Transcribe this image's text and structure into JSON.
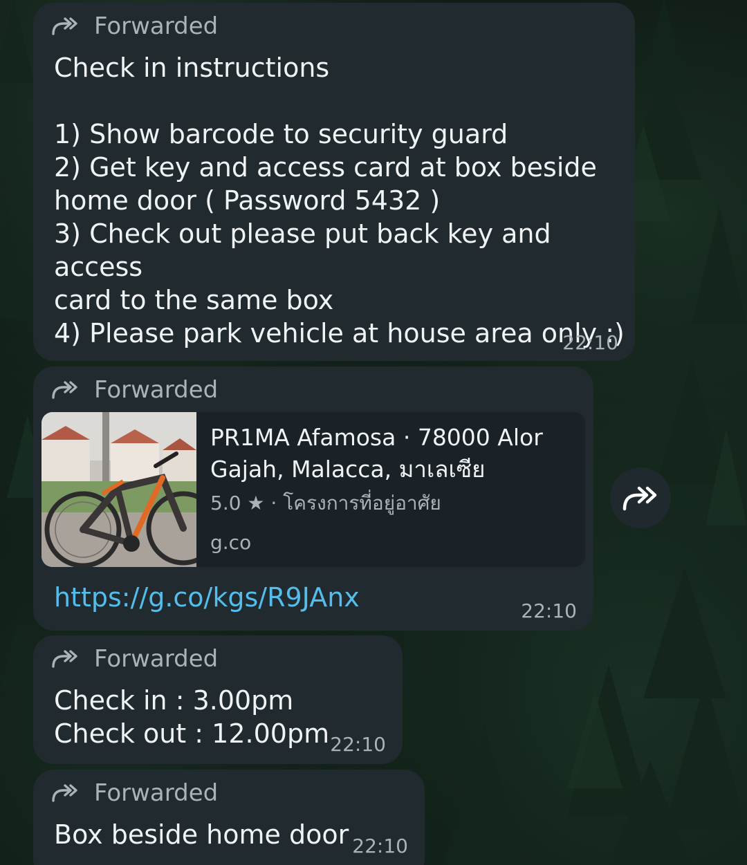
{
  "colors": {
    "bubble": "#212a2f",
    "link": "#53bdeb",
    "secondary_text": "#a9b4b9"
  },
  "messages": [
    {
      "forwarded_label": "Forwarded",
      "forward_icon": "forwarded-arrow-icon",
      "text": "Check in instructions\n\n1) Show barcode to security guard\n2) Get key and access card at box beside\nhome door ( Password 5432 )\n3) Check out please put back key and access\ncard to the same box\n4) Please park vehicle at house area only :)",
      "time": "22:10"
    },
    {
      "forwarded_label": "Forwarded",
      "forward_icon": "forwarded-arrow-icon",
      "preview": {
        "title": "PR1MA Afamosa · 78000 Alor Gajah, Malacca, มาเลเซีย",
        "subtitle": "5.0 ★ · โครงการที่อยู่อาศัย",
        "domain": "g.co",
        "thumbnail": "bicycle-photo"
      },
      "url": "https://g.co/kgs/R9JAnx",
      "time": "22:10"
    },
    {
      "forwarded_label": "Forwarded",
      "forward_icon": "forwarded-arrow-icon",
      "text": "Check in : 3.00pm\nCheck out : 12.00pm",
      "time": "22:10"
    },
    {
      "forwarded_label": "Forwarded",
      "forward_icon": "forwarded-arrow-icon",
      "text": "Box beside home door",
      "time": "22:10"
    }
  ],
  "share_button": {
    "icon": "share-forward-icon"
  }
}
